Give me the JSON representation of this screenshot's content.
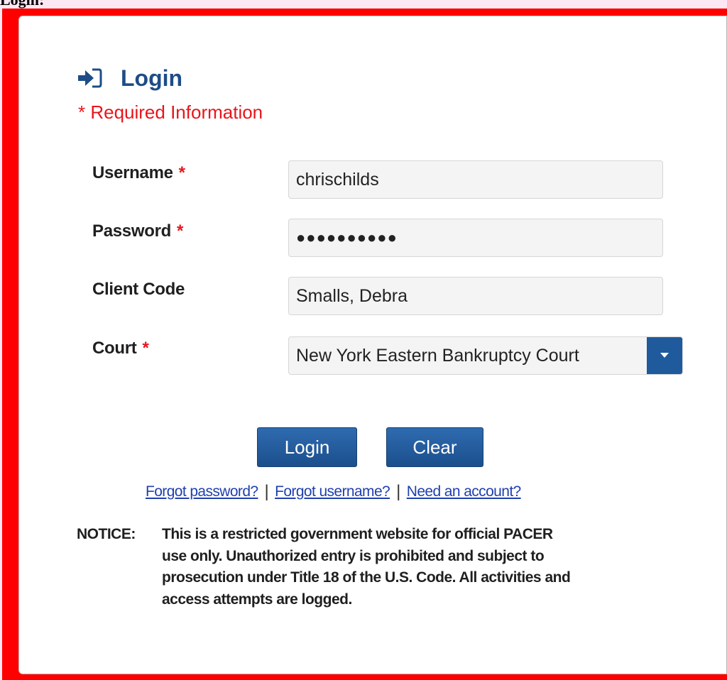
{
  "page": {
    "top_label": "Login:"
  },
  "login": {
    "title": "Login",
    "required_note": "* Required Information",
    "fields": {
      "username": {
        "label": "Username",
        "required_mark": "*",
        "value": "chrischilds"
      },
      "password": {
        "label": "Password",
        "required_mark": "*",
        "value": "●●●●●●●●●●"
      },
      "client_code": {
        "label": "Client Code",
        "value": "Smalls, Debra"
      },
      "court": {
        "label": "Court",
        "required_mark": "*",
        "selected": "New York Eastern Bankruptcy Court"
      }
    },
    "buttons": {
      "login": "Login",
      "clear": "Clear"
    },
    "links": {
      "forgot_password": "Forgot password?",
      "forgot_username": "Forgot username?",
      "need_account": "Need an account?",
      "separator": "|"
    },
    "notice": {
      "label": "NOTICE:",
      "line1": "This is a restricted government website for official PACER",
      "line2": "use only. Unauthorized entry is prohibited and subject to",
      "line3": "prosecution under Title 18 of the U.S. Code. All activities and",
      "line4": "access attempts are logged."
    }
  },
  "icons": {
    "heading_icon": "sign-in-icon",
    "dropdown_icon": "caret-down-icon"
  },
  "colors": {
    "frame_red": "#ff0000",
    "heading_blue": "#1d4d87",
    "required_red": "#e8151b",
    "button_blue": "#1e5a9c",
    "link_blue": "#1f3fb0",
    "page_bg": "#fce8f3"
  }
}
